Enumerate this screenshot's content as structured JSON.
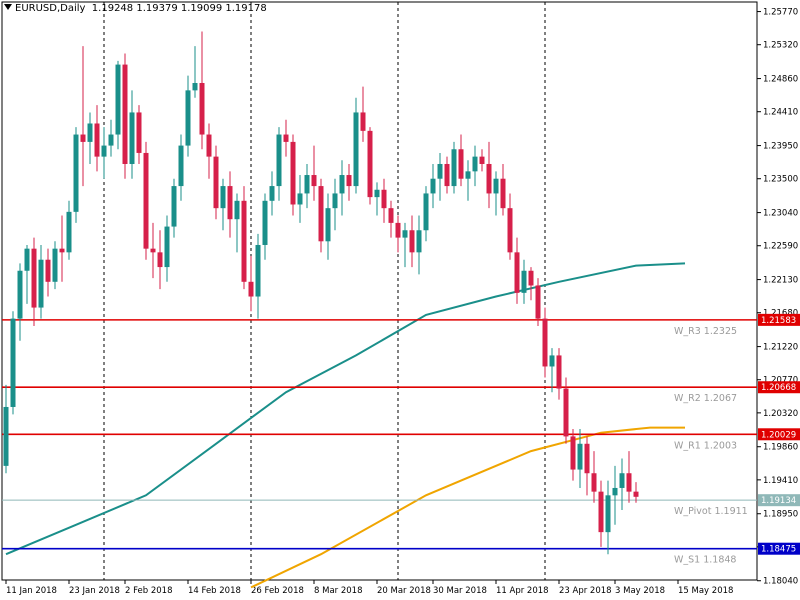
{
  "header": {
    "symbol": "EURUSD,Daily",
    "ohlc": "1.19248 1.19379 1.19099 1.19178"
  },
  "colors": {
    "bull": "#1a8f8a",
    "bear": "#d6204a",
    "ma_fast": "#1a8f8a",
    "ma_slow": "#f0a500",
    "pivot_red": "#e00000",
    "support_blue": "#0000c8",
    "pivot_line": "#8fb8b8"
  },
  "chart_data": {
    "type": "candlestick",
    "grid": "vertical-dashed",
    "ylim": [
      1.1805,
      1.259
    ],
    "y_ticks": [
      "1.25770",
      "1.25320",
      "1.24860",
      "1.24410",
      "1.23950",
      "1.23500",
      "1.23040",
      "1.22590",
      "1.22130",
      "1.21680",
      "1.21220",
      "1.20770",
      "1.20320",
      "1.19860",
      "1.19410",
      "1.18950",
      "1.18500",
      "1.18040"
    ],
    "x_ticks": [
      "11 Jan 2018",
      "23 Jan 2018",
      "2 Feb 2018",
      "14 Feb 2018",
      "26 Feb 2018",
      "8 Mar 2018",
      "20 Mar 2018",
      "30 Mar 2018",
      "11 Apr 2018",
      "23 Apr 2018",
      "3 May 2018",
      "15 May 2018"
    ],
    "x_tick_index": [
      0,
      9,
      17,
      26,
      35,
      44,
      53,
      61,
      70,
      79,
      87,
      96
    ],
    "separator_index": [
      14,
      35,
      56,
      77
    ],
    "candles": [
      [
        1.196,
        1.207,
        1.195,
        1.204
      ],
      [
        1.204,
        1.217,
        1.203,
        1.216
      ],
      [
        1.216,
        1.2235,
        1.213,
        1.2225
      ],
      [
        1.2225,
        1.226,
        1.218,
        1.2255
      ],
      [
        1.2255,
        1.227,
        1.215,
        1.2175
      ],
      [
        1.2175,
        1.226,
        1.216,
        1.224
      ],
      [
        1.224,
        1.2255,
        1.219,
        1.221
      ],
      [
        1.221,
        1.2265,
        1.22,
        1.2255
      ],
      [
        1.2255,
        1.23,
        1.221,
        1.225
      ],
      [
        1.225,
        1.232,
        1.224,
        1.2305
      ],
      [
        1.2305,
        1.242,
        1.229,
        1.241
      ],
      [
        1.241,
        1.253,
        1.234,
        1.24
      ],
      [
        1.24,
        1.244,
        1.237,
        1.2425
      ],
      [
        1.2425,
        1.245,
        1.236,
        1.238
      ],
      [
        1.238,
        1.242,
        1.235,
        1.2395
      ],
      [
        1.2395,
        1.243,
        1.238,
        1.241
      ],
      [
        1.241,
        1.251,
        1.239,
        1.2505
      ],
      [
        1.2505,
        1.252,
        1.235,
        1.237
      ],
      [
        1.237,
        1.247,
        1.235,
        1.244
      ],
      [
        1.244,
        1.245,
        1.237,
        1.2385
      ],
      [
        1.2385,
        1.24,
        1.224,
        1.2255
      ],
      [
        1.2255,
        1.229,
        1.2215,
        1.225
      ],
      [
        1.225,
        1.228,
        1.22,
        1.223
      ],
      [
        1.223,
        1.23,
        1.221,
        1.2285
      ],
      [
        1.2285,
        1.235,
        1.227,
        1.234
      ],
      [
        1.234,
        1.241,
        1.232,
        1.2395
      ],
      [
        1.2395,
        1.249,
        1.238,
        1.247
      ],
      [
        1.247,
        1.253,
        1.246,
        1.248
      ],
      [
        1.248,
        1.255,
        1.239,
        1.241
      ],
      [
        1.241,
        1.2425,
        1.235,
        1.238
      ],
      [
        1.238,
        1.2395,
        1.2295,
        1.231
      ],
      [
        1.231,
        1.235,
        1.228,
        1.234
      ],
      [
        1.234,
        1.236,
        1.227,
        1.2295
      ],
      [
        1.2295,
        1.233,
        1.225,
        1.232
      ],
      [
        1.232,
        1.234,
        1.22,
        1.221
      ],
      [
        1.221,
        1.2245,
        1.217,
        1.219
      ],
      [
        1.219,
        1.2275,
        1.216,
        1.226
      ],
      [
        1.226,
        1.233,
        1.224,
        1.232
      ],
      [
        1.232,
        1.236,
        1.23,
        1.234
      ],
      [
        1.234,
        1.242,
        1.232,
        1.241
      ],
      [
        1.241,
        1.243,
        1.238,
        1.24
      ],
      [
        1.24,
        1.241,
        1.23,
        1.2315
      ],
      [
        1.2315,
        1.2355,
        1.229,
        1.233
      ],
      [
        1.233,
        1.237,
        1.231,
        1.2355
      ],
      [
        1.2355,
        1.2395,
        1.232,
        1.234
      ],
      [
        1.234,
        1.235,
        1.225,
        1.2265
      ],
      [
        1.2265,
        1.233,
        1.224,
        1.231
      ],
      [
        1.231,
        1.235,
        1.228,
        1.233
      ],
      [
        1.233,
        1.2375,
        1.23,
        1.2355
      ],
      [
        1.2355,
        1.237,
        1.232,
        1.234
      ],
      [
        1.234,
        1.246,
        1.233,
        1.244
      ],
      [
        1.244,
        1.2475,
        1.24,
        1.2415
      ],
      [
        1.2415,
        1.242,
        1.2315,
        1.2325
      ],
      [
        1.2325,
        1.2345,
        1.23,
        1.2335
      ],
      [
        1.2335,
        1.235,
        1.229,
        1.231
      ],
      [
        1.231,
        1.232,
        1.227,
        1.229
      ],
      [
        1.229,
        1.23,
        1.225,
        1.227
      ],
      [
        1.227,
        1.229,
        1.223,
        1.228
      ],
      [
        1.228,
        1.23,
        1.223,
        1.225
      ],
      [
        1.225,
        1.23,
        1.222,
        1.228
      ],
      [
        1.228,
        1.234,
        1.2265,
        1.233
      ],
      [
        1.233,
        1.237,
        1.231,
        1.235
      ],
      [
        1.235,
        1.2385,
        1.232,
        1.237
      ],
      [
        1.237,
        1.238,
        1.233,
        1.234
      ],
      [
        1.234,
        1.24,
        1.233,
        1.239
      ],
      [
        1.239,
        1.241,
        1.234,
        1.235
      ],
      [
        1.235,
        1.2375,
        1.232,
        1.236
      ],
      [
        1.236,
        1.2395,
        1.234,
        1.238
      ],
      [
        1.238,
        1.239,
        1.236,
        1.237
      ],
      [
        1.237,
        1.24,
        1.231,
        1.233
      ],
      [
        1.233,
        1.236,
        1.23,
        1.235
      ],
      [
        1.235,
        1.237,
        1.23,
        1.231
      ],
      [
        1.231,
        1.233,
        1.224,
        1.225
      ],
      [
        1.225,
        1.227,
        1.218,
        1.2195
      ],
      [
        1.2195,
        1.224,
        1.218,
        1.2225
      ],
      [
        1.2225,
        1.223,
        1.2185,
        1.2205
      ],
      [
        1.2205,
        1.2215,
        1.215,
        1.216
      ],
      [
        1.216,
        1.2175,
        1.208,
        1.2095
      ],
      [
        1.2095,
        1.212,
        1.206,
        1.211
      ],
      [
        1.211,
        1.212,
        1.205,
        1.2065
      ],
      [
        1.2065,
        1.208,
        1.199,
        1.2
      ],
      [
        1.2,
        1.201,
        1.194,
        1.1955
      ],
      [
        1.1955,
        1.201,
        1.193,
        1.199
      ],
      [
        1.199,
        1.2,
        1.192,
        1.195
      ],
      [
        1.195,
        1.198,
        1.191,
        1.1925
      ],
      [
        1.1925,
        1.194,
        1.185,
        1.187
      ],
      [
        1.187,
        1.194,
        1.184,
        1.192
      ],
      [
        1.192,
        1.196,
        1.188,
        1.193
      ],
      [
        1.193,
        1.197,
        1.19,
        1.195
      ],
      [
        1.195,
        1.198,
        1.191,
        1.1925
      ],
      [
        1.1925,
        1.1938,
        1.191,
        1.1918
      ]
    ],
    "ma_fast": [
      [
        0,
        1.184
      ],
      [
        10,
        1.188
      ],
      [
        20,
        1.192
      ],
      [
        30,
        1.199
      ],
      [
        40,
        1.206
      ],
      [
        50,
        1.211
      ],
      [
        60,
        1.2165
      ],
      [
        70,
        1.219
      ],
      [
        79,
        1.221
      ],
      [
        90,
        1.2232
      ],
      [
        97,
        1.2235
      ]
    ],
    "ma_slow": [
      [
        35,
        1.1795
      ],
      [
        45,
        1.184
      ],
      [
        60,
        1.192
      ],
      [
        75,
        1.198
      ],
      [
        85,
        1.2005
      ],
      [
        92,
        1.2012
      ],
      [
        97,
        1.2012
      ]
    ],
    "levels": [
      {
        "price": 1.21583,
        "badge": "1.21583",
        "label": "W_R3 1.2325",
        "color_key": "pivot_red"
      },
      {
        "price": 1.20668,
        "badge": "1.20668",
        "label": "W_R2 1.2067",
        "color_key": "pivot_red"
      },
      {
        "price": 1.20029,
        "badge": "1.20029",
        "label": "W_R1 1.2003",
        "color_key": "pivot_red"
      },
      {
        "price": 1.19134,
        "badge": "1.19134",
        "label": "W_Pivot 1.1911",
        "color_key": "pivot_line"
      },
      {
        "price": 1.18475,
        "badge": "1.18475",
        "label": "W_S1 1.1848",
        "color_key": "support_blue"
      }
    ],
    "last_price": 1.19178
  }
}
